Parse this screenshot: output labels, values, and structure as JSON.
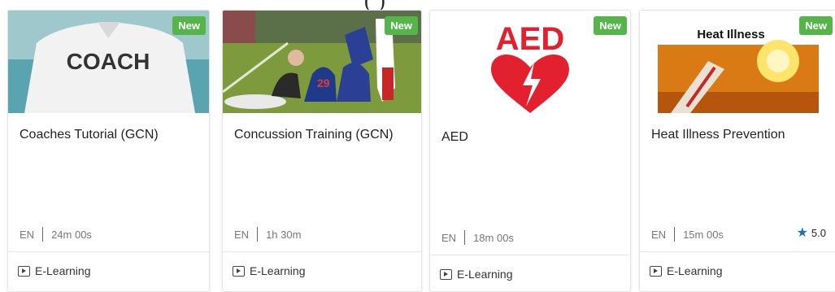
{
  "header_fragment": "(       )",
  "cards": [
    {
      "badge": "New",
      "title": "Coaches Tutorial (GCN)",
      "lang": "EN",
      "duration": "24m 00s",
      "type": "E-Learning",
      "image": {
        "text": "COACH"
      }
    },
    {
      "badge": "New",
      "title": "Concussion Training (GCN)",
      "lang": "EN",
      "duration": "1h 30m",
      "type": "E-Learning",
      "image": {
        "jersey_number": "29"
      }
    },
    {
      "badge": "New",
      "title": "AED",
      "lang": "EN",
      "duration": "18m 00s",
      "type": "E-Learning",
      "image": {
        "text": "AED"
      }
    },
    {
      "badge": "New",
      "title": "Heat Illness Prevention",
      "lang": "EN",
      "duration": "15m 00s",
      "type": "E-Learning",
      "rating": "5.0",
      "image": {
        "text": "Heat Illness"
      }
    }
  ],
  "colors": {
    "badge": "#55b54a",
    "star": "#1f6fb5",
    "aed_red": "#e3202e"
  }
}
